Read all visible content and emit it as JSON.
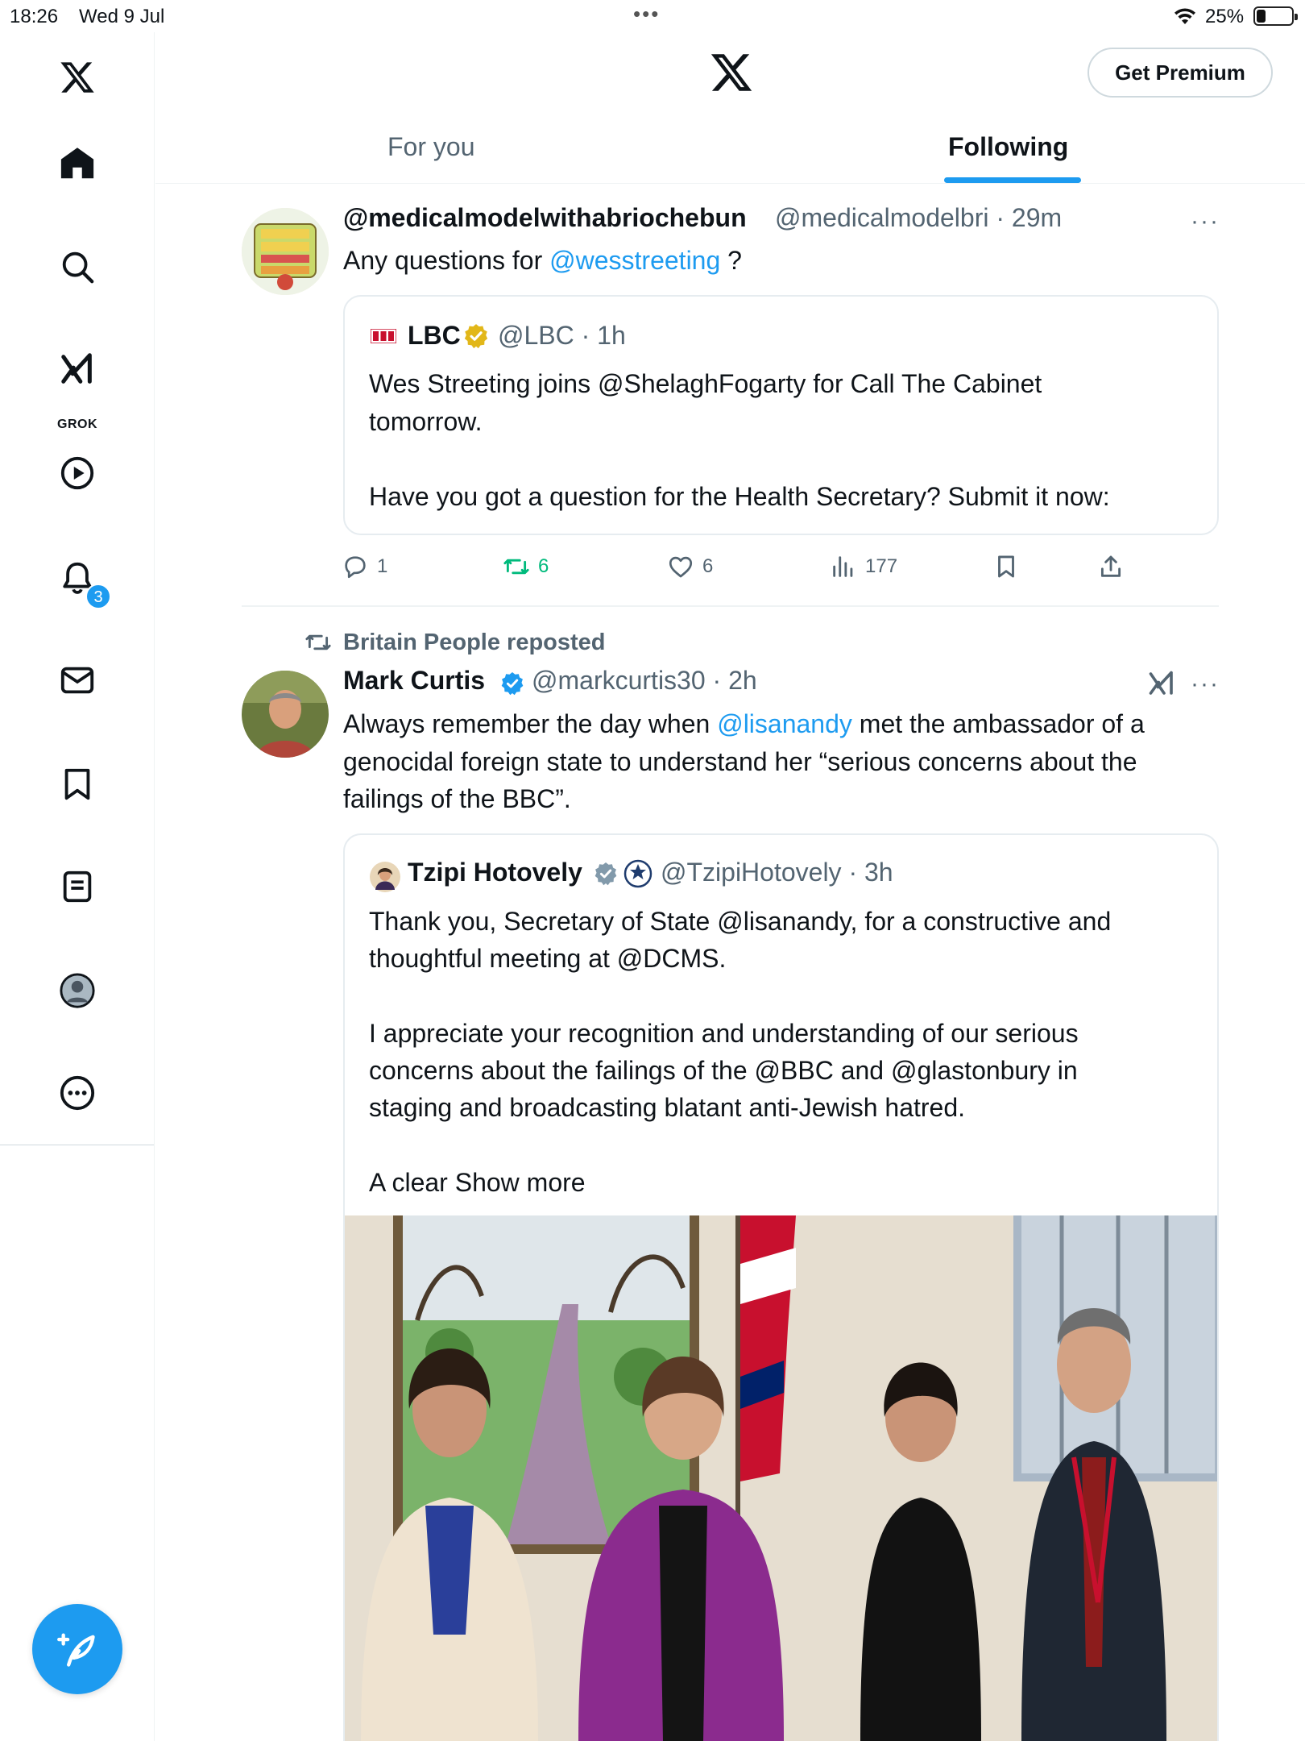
{
  "status_bar": {
    "time": "18:26",
    "date": "Wed 9 Jul",
    "dots": "•••",
    "battery_percent": "25%",
    "battery_level": 0.25
  },
  "header": {
    "premium_button": "Get Premium",
    "tabs": [
      {
        "label": "For you",
        "active": false
      },
      {
        "label": "Following",
        "active": true
      }
    ]
  },
  "sidebar": {
    "items": [
      {
        "name": "home",
        "icon": "home-icon"
      },
      {
        "name": "search",
        "icon": "search-icon"
      },
      {
        "name": "grok",
        "icon": "grok-icon",
        "label": "GROK"
      },
      {
        "name": "videos",
        "icon": "play-icon"
      },
      {
        "name": "notifications",
        "icon": "bell-icon",
        "badge": "3"
      },
      {
        "name": "messages",
        "icon": "mail-icon"
      },
      {
        "name": "bookmarks",
        "icon": "bookmark-icon"
      },
      {
        "name": "lists",
        "icon": "list-icon"
      },
      {
        "name": "profile",
        "icon": "profile-icon"
      },
      {
        "name": "more",
        "icon": "more-icon"
      }
    ]
  },
  "posts": [
    {
      "display_name": "@medicalmodelwithabriochebun",
      "handle_time": "@medicalmodelbri · 29m",
      "text_before": "Any questions for ",
      "mention": "@wesstreeting",
      "text_after": " ?",
      "quote": {
        "name": "LBC",
        "handle_time": "@LBC · 1h",
        "lines": [
          "Wes Streeting joins @ShelaghFogarty for Call The Cabinet",
          "tomorrow.",
          "",
          "Have you got a question for the Health Secretary? Submit it now:"
        ]
      },
      "actions": {
        "replies": "1",
        "reposts": "6",
        "likes": "6",
        "views": "177"
      }
    },
    {
      "repost_label": "Britain People reposted",
      "display_name": "Mark Curtis",
      "handle_time": "@markcurtis30 · 2h",
      "line1_before": "Always remember the day when ",
      "line1_mention": "@lisanandy",
      "line1_after": " met the ambassador of a",
      "line2": "genocidal foreign state to understand her “serious concerns about the",
      "line3": "failings of the BBC”.",
      "quote": {
        "name": "Tzipi Hotovely",
        "handle_time": "@TzipiHotovely · 3h",
        "lines": [
          "Thank you, Secretary of State @lisanandy, for a constructive and",
          "thoughtful meeting at @DCMS.",
          "",
          "I appreciate your recognition and understanding of our serious",
          "concerns about the failings of the @BBC and @glastonbury in",
          "staging and broadcasting blatant anti-Jewish hatred.",
          "",
          "A clear Show more"
        ]
      }
    }
  ],
  "colors": {
    "accent": "#1d9bf0",
    "repost_green": "#00ba7c",
    "muted": "#536471",
    "verified_gold": "#e2b719",
    "verified_grey": "#829aab"
  }
}
